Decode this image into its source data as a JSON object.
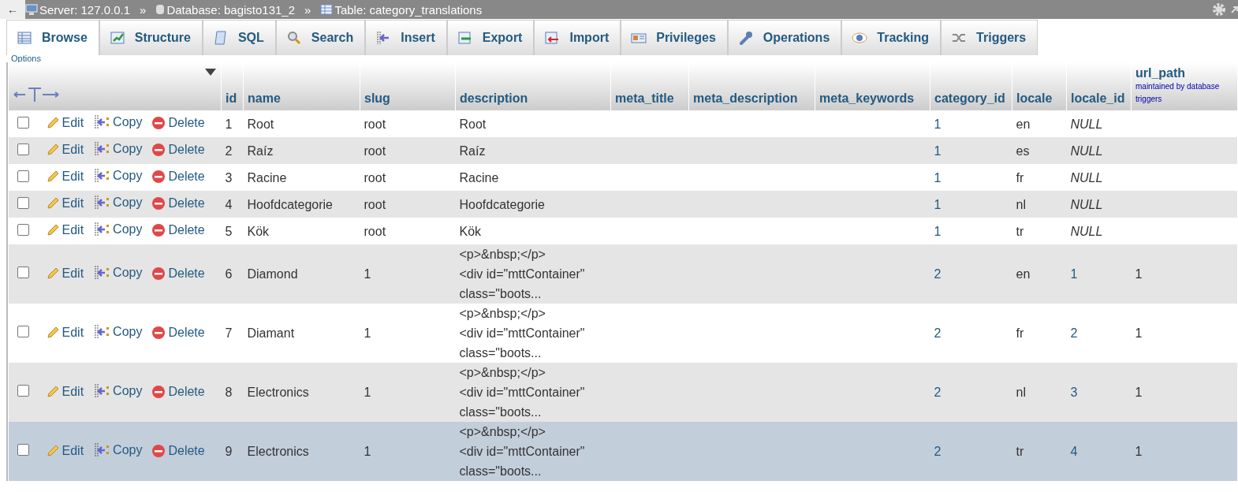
{
  "breadcrumb": [
    {
      "kind": "server",
      "label": "Server: 127.0.0.1"
    },
    {
      "kind": "database",
      "label": "Database: bagisto131_2"
    },
    {
      "kind": "table",
      "label": "Table: category_translations"
    }
  ],
  "breadcrumb_separator": "»",
  "back_arrow": "←",
  "tabs": [
    {
      "kind": "browse",
      "label": "Browse",
      "selected": true
    },
    {
      "kind": "structure",
      "label": "Structure",
      "selected": false
    },
    {
      "kind": "sql",
      "label": "SQL",
      "selected": false
    },
    {
      "kind": "search",
      "label": "Search",
      "selected": false
    },
    {
      "kind": "insert",
      "label": "Insert",
      "selected": false
    },
    {
      "kind": "export",
      "label": "Export",
      "selected": false
    },
    {
      "kind": "import",
      "label": "Import",
      "selected": false
    },
    {
      "kind": "privileges",
      "label": "Privileges",
      "selected": false
    },
    {
      "kind": "operations",
      "label": "Operations",
      "selected": false
    },
    {
      "kind": "tracking",
      "label": "Tracking",
      "selected": false
    },
    {
      "kind": "triggers",
      "label": "Triggers",
      "selected": false
    }
  ],
  "options_label": "Options",
  "columns": [
    {
      "label": "id"
    },
    {
      "label": "name"
    },
    {
      "label": "slug"
    },
    {
      "label": "description"
    },
    {
      "label": "meta_title"
    },
    {
      "label": "meta_description"
    },
    {
      "label": "meta_keywords"
    },
    {
      "label": "category_id"
    },
    {
      "label": "locale"
    },
    {
      "label": "locale_id"
    },
    {
      "label": "url_path",
      "note": "maintained by database triggers"
    }
  ],
  "rows": [
    {
      "checked": false,
      "highlighted": false,
      "actions": [
        "Edit",
        "Copy",
        "Delete"
      ],
      "cells": [
        {
          "text": "1",
          "kind": "text"
        },
        {
          "text": "Root",
          "kind": "text"
        },
        {
          "text": "root",
          "kind": "text"
        },
        {
          "text": "Root",
          "kind": "text"
        },
        null,
        null,
        null,
        {
          "text": "1",
          "kind": "link"
        },
        {
          "text": "en",
          "kind": "text"
        },
        {
          "text": "NULL",
          "kind": "null"
        },
        null
      ]
    },
    {
      "checked": false,
      "highlighted": false,
      "actions": [
        "Edit",
        "Copy",
        "Delete"
      ],
      "cells": [
        {
          "text": "2",
          "kind": "text"
        },
        {
          "text": "Raíz",
          "kind": "text"
        },
        {
          "text": "root",
          "kind": "text"
        },
        {
          "text": "Raíz",
          "kind": "text"
        },
        null,
        null,
        null,
        {
          "text": "1",
          "kind": "link"
        },
        {
          "text": "es",
          "kind": "text"
        },
        {
          "text": "NULL",
          "kind": "null"
        },
        null
      ]
    },
    {
      "checked": false,
      "highlighted": false,
      "actions": [
        "Edit",
        "Copy",
        "Delete"
      ],
      "cells": [
        {
          "text": "3",
          "kind": "text"
        },
        {
          "text": "Racine",
          "kind": "text"
        },
        {
          "text": "root",
          "kind": "text"
        },
        {
          "text": "Racine",
          "kind": "text"
        },
        null,
        null,
        null,
        {
          "text": "1",
          "kind": "link"
        },
        {
          "text": "fr",
          "kind": "text"
        },
        {
          "text": "NULL",
          "kind": "null"
        },
        null
      ]
    },
    {
      "checked": false,
      "highlighted": false,
      "actions": [
        "Edit",
        "Copy",
        "Delete"
      ],
      "cells": [
        {
          "text": "4",
          "kind": "text"
        },
        {
          "text": "Hoofdcategorie",
          "kind": "text"
        },
        {
          "text": "root",
          "kind": "text"
        },
        {
          "text": "Hoofdcategorie",
          "kind": "text"
        },
        null,
        null,
        null,
        {
          "text": "1",
          "kind": "link"
        },
        {
          "text": "nl",
          "kind": "text"
        },
        {
          "text": "NULL",
          "kind": "null"
        },
        null
      ]
    },
    {
      "checked": false,
      "highlighted": false,
      "actions": [
        "Edit",
        "Copy",
        "Delete"
      ],
      "cells": [
        {
          "text": "5",
          "kind": "text"
        },
        {
          "text": "Kök",
          "kind": "text"
        },
        {
          "text": "root",
          "kind": "text"
        },
        {
          "text": "Kök",
          "kind": "text"
        },
        null,
        null,
        null,
        {
          "text": "1",
          "kind": "link"
        },
        {
          "text": "tr",
          "kind": "text"
        },
        {
          "text": "NULL",
          "kind": "null"
        },
        null
      ]
    },
    {
      "checked": false,
      "highlighted": false,
      "actions": [
        "Edit",
        "Copy",
        "Delete"
      ],
      "cells": [
        {
          "text": "6",
          "kind": "text"
        },
        {
          "text": "Diamond",
          "kind": "text"
        },
        {
          "text": "1",
          "kind": "text"
        },
        {
          "text": "<p>&nbsp;</p>\n<div id=\"mttContainer\"\nclass=\"boots...",
          "kind": "text"
        },
        null,
        null,
        null,
        {
          "text": "2",
          "kind": "link"
        },
        {
          "text": "en",
          "kind": "text"
        },
        {
          "text": "1",
          "kind": "link"
        },
        {
          "text": "1",
          "kind": "text"
        }
      ]
    },
    {
      "checked": false,
      "highlighted": false,
      "actions": [
        "Edit",
        "Copy",
        "Delete"
      ],
      "cells": [
        {
          "text": "7",
          "kind": "text"
        },
        {
          "text": "Diamant",
          "kind": "text"
        },
        {
          "text": "1",
          "kind": "text"
        },
        {
          "text": "<p>&nbsp;</p>\n<div id=\"mttContainer\"\nclass=\"boots...",
          "kind": "text"
        },
        null,
        null,
        null,
        {
          "text": "2",
          "kind": "link"
        },
        {
          "text": "fr",
          "kind": "text"
        },
        {
          "text": "2",
          "kind": "link"
        },
        {
          "text": "1",
          "kind": "text"
        }
      ]
    },
    {
      "checked": false,
      "highlighted": false,
      "actions": [
        "Edit",
        "Copy",
        "Delete"
      ],
      "cells": [
        {
          "text": "8",
          "kind": "text"
        },
        {
          "text": "Electronics",
          "kind": "text"
        },
        {
          "text": "1",
          "kind": "text"
        },
        {
          "text": "<p>&nbsp;</p>\n<div id=\"mttContainer\"\nclass=\"boots...",
          "kind": "text"
        },
        null,
        null,
        null,
        {
          "text": "2",
          "kind": "link"
        },
        {
          "text": "nl",
          "kind": "text"
        },
        {
          "text": "3",
          "kind": "link"
        },
        {
          "text": "1",
          "kind": "text"
        }
      ]
    },
    {
      "checked": false,
      "highlighted": true,
      "actions": [
        "Edit",
        "Copy",
        "Delete"
      ],
      "cells": [
        {
          "text": "9",
          "kind": "text"
        },
        {
          "text": "Electronics",
          "kind": "text"
        },
        {
          "text": "1",
          "kind": "text"
        },
        {
          "text": "<p>&nbsp;</p>\n<div id=\"mttContainer\"\nclass=\"boots...",
          "kind": "text"
        },
        null,
        null,
        null,
        {
          "text": "2",
          "kind": "link"
        },
        {
          "text": "tr",
          "kind": "text"
        },
        {
          "text": "4",
          "kind": "link"
        },
        {
          "text": "1",
          "kind": "text"
        }
      ]
    }
  ]
}
